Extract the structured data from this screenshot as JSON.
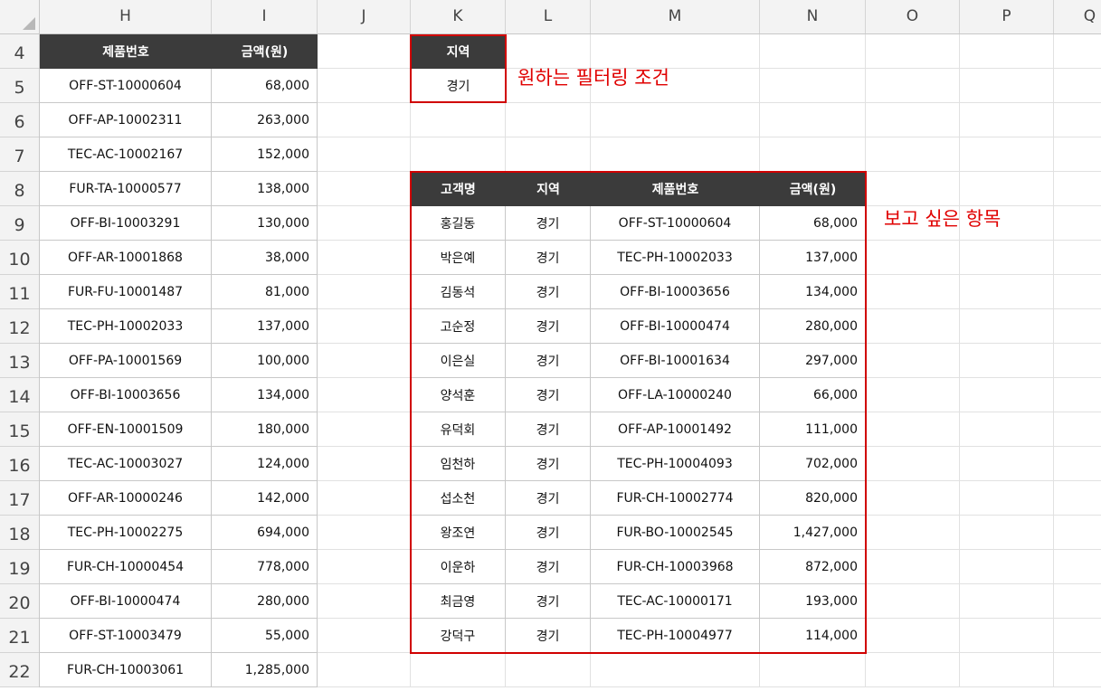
{
  "columns": [
    "H",
    "I",
    "J",
    "K",
    "L",
    "M",
    "N",
    "O",
    "P",
    "Q"
  ],
  "rows": [
    "4",
    "5",
    "6",
    "7",
    "8",
    "9",
    "10",
    "11",
    "12",
    "13",
    "14",
    "15",
    "16",
    "17",
    "18",
    "19",
    "20",
    "21",
    "22"
  ],
  "left_table": {
    "headers": [
      "제품번호",
      "금액(원)"
    ],
    "rows": [
      [
        "OFF-ST-10000604",
        "68,000"
      ],
      [
        "OFF-AP-10002311",
        "263,000"
      ],
      [
        "TEC-AC-10002167",
        "152,000"
      ],
      [
        "FUR-TA-10000577",
        "138,000"
      ],
      [
        "OFF-BI-10003291",
        "130,000"
      ],
      [
        "OFF-AR-10001868",
        "38,000"
      ],
      [
        "FUR-FU-10001487",
        "81,000"
      ],
      [
        "TEC-PH-10002033",
        "137,000"
      ],
      [
        "OFF-PA-10001569",
        "100,000"
      ],
      [
        "OFF-BI-10003656",
        "134,000"
      ],
      [
        "OFF-EN-10001509",
        "180,000"
      ],
      [
        "TEC-AC-10003027",
        "124,000"
      ],
      [
        "OFF-AR-10000246",
        "142,000"
      ],
      [
        "TEC-PH-10002275",
        "694,000"
      ],
      [
        "FUR-CH-10000454",
        "778,000"
      ],
      [
        "OFF-BI-10000474",
        "280,000"
      ],
      [
        "OFF-ST-10003479",
        "55,000"
      ],
      [
        "FUR-CH-10003061",
        "1,285,000"
      ]
    ]
  },
  "criteria": {
    "header": "지역",
    "value": "경기",
    "annotation": "원하는 필터링 조건"
  },
  "result_table": {
    "annotation": "보고 싶은 항목",
    "headers": [
      "고객명",
      "지역",
      "제품번호",
      "금액(원)"
    ],
    "rows": [
      [
        "홍길동",
        "경기",
        "OFF-ST-10000604",
        "68,000"
      ],
      [
        "박은예",
        "경기",
        "TEC-PH-10002033",
        "137,000"
      ],
      [
        "김동석",
        "경기",
        "OFF-BI-10003656",
        "134,000"
      ],
      [
        "고순정",
        "경기",
        "OFF-BI-10000474",
        "280,000"
      ],
      [
        "이은실",
        "경기",
        "OFF-BI-10001634",
        "297,000"
      ],
      [
        "양석훈",
        "경기",
        "OFF-LA-10000240",
        "66,000"
      ],
      [
        "유덕회",
        "경기",
        "OFF-AP-10001492",
        "111,000"
      ],
      [
        "임천하",
        "경기",
        "TEC-PH-10004093",
        "702,000"
      ],
      [
        "섭소천",
        "경기",
        "FUR-CH-10002774",
        "820,000"
      ],
      [
        "왕조연",
        "경기",
        "FUR-BO-10002545",
        "1,427,000"
      ],
      [
        "이운하",
        "경기",
        "FUR-CH-10003968",
        "872,000"
      ],
      [
        "최금영",
        "경기",
        "TEC-AC-10000171",
        "193,000"
      ],
      [
        "강덕구",
        "경기",
        "TEC-PH-10004977",
        "114,000"
      ]
    ]
  },
  "colors": {
    "header_bg": "#3b3b3b",
    "highlight_border": "#d00000",
    "annotation_text": "#e00000"
  }
}
